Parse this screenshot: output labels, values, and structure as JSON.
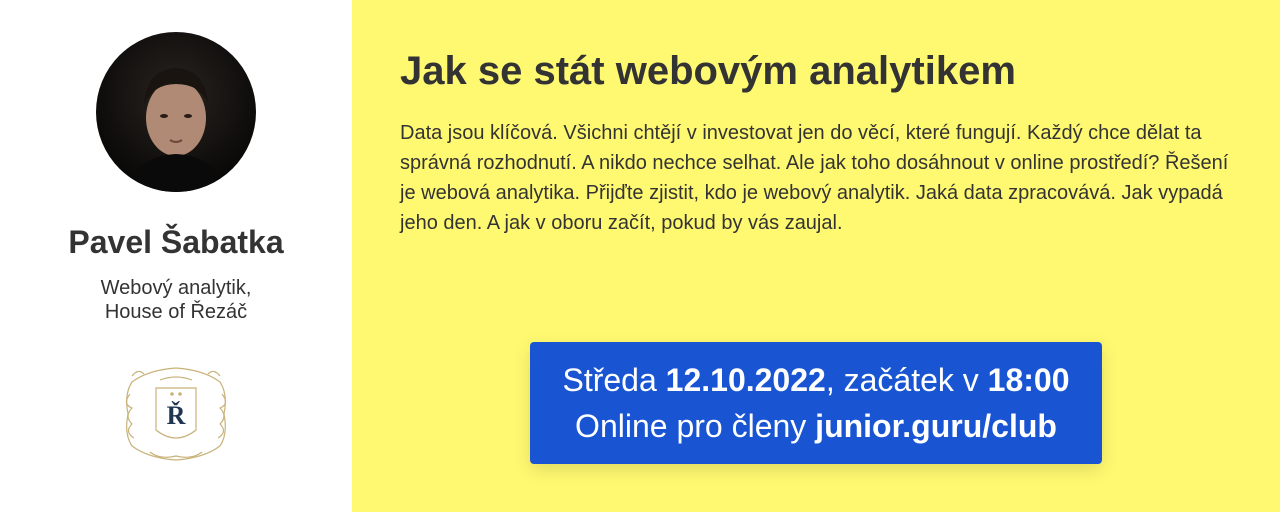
{
  "speaker": {
    "name": "Pavel Šabatka",
    "role_line1": "Webový analytik,",
    "role_line2": "House of Řezáč",
    "company_logo_letter": "Ř"
  },
  "event": {
    "title": "Jak se stát webovým analytikem",
    "description": "Data jsou klíčová. Všichni chtějí v investovat jen do věcí, které fungují. Každý chce dělat ta správná rozhodnutí. A nikdo nechce selhat. Ale jak toho dosáhnout v online prostředí? Řešení je webová analytika. Přijďte zjistit, kdo je webový analytik. Jaká data zpracovává. Jak vypadá jeho den. A jak v oboru začít, pokud by vás zaujal.",
    "day_prefix": "Středa ",
    "date": "12.10.2022",
    "time_prefix": ", začátek v ",
    "time": "18:00",
    "online_prefix": "Online pro členy ",
    "club_link": "junior.guru/club"
  },
  "colors": {
    "left_bg": "#ffffff",
    "right_bg": "#fff971",
    "info_box_bg": "#1955d3",
    "logo_gold": "#c9b27a",
    "logo_navy": "#1f3550"
  }
}
